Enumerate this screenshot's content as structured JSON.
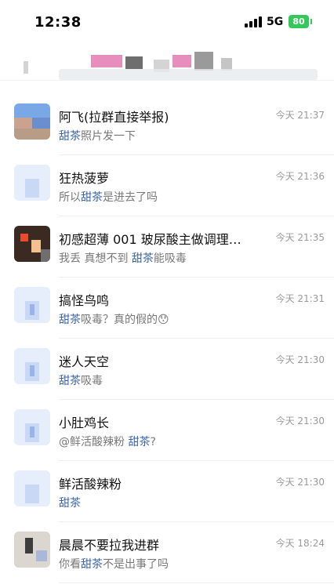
{
  "status_bar": {
    "time": "12:38",
    "network": "5G",
    "battery": "80"
  },
  "chats": [
    {
      "name": "阿飞(拉群直接举报)",
      "time": "今天 21:37",
      "mention": "甜茶",
      "pre": "",
      "post": "照片发一下"
    },
    {
      "name": "狂热菠萝",
      "time": "今天 21:36",
      "mention": "甜茶",
      "pre": "所以",
      "post": "是进去了吗"
    },
    {
      "name": "初感超薄 001 玻尿酸主做调理…",
      "time": "今天 21:35",
      "mention": "甜茶",
      "pre": "我丢 真想不到 ",
      "post": "能吸毒"
    },
    {
      "name": "搞怪鸟鸣",
      "time": "今天 21:31",
      "mention": "甜茶",
      "pre": "",
      "post": "吸毒？真的假的😯"
    },
    {
      "name": "迷人天空",
      "time": "今天 21:30",
      "mention": "甜茶",
      "pre": "",
      "post": "吸毒"
    },
    {
      "name": "小肚鸡长",
      "time": "今天 21:30",
      "mention": "甜茶",
      "pre": "@鲜活酸辣粉 ",
      "post": "?"
    },
    {
      "name": "鲜活酸辣粉",
      "time": "今天 21:30",
      "mention": "甜茶",
      "pre": "",
      "post": ""
    },
    {
      "name": "晨晨不要拉我进群",
      "time": "今天 18:24",
      "mention": "甜茶",
      "pre": "你看",
      "post": "不是出事了吗"
    }
  ]
}
